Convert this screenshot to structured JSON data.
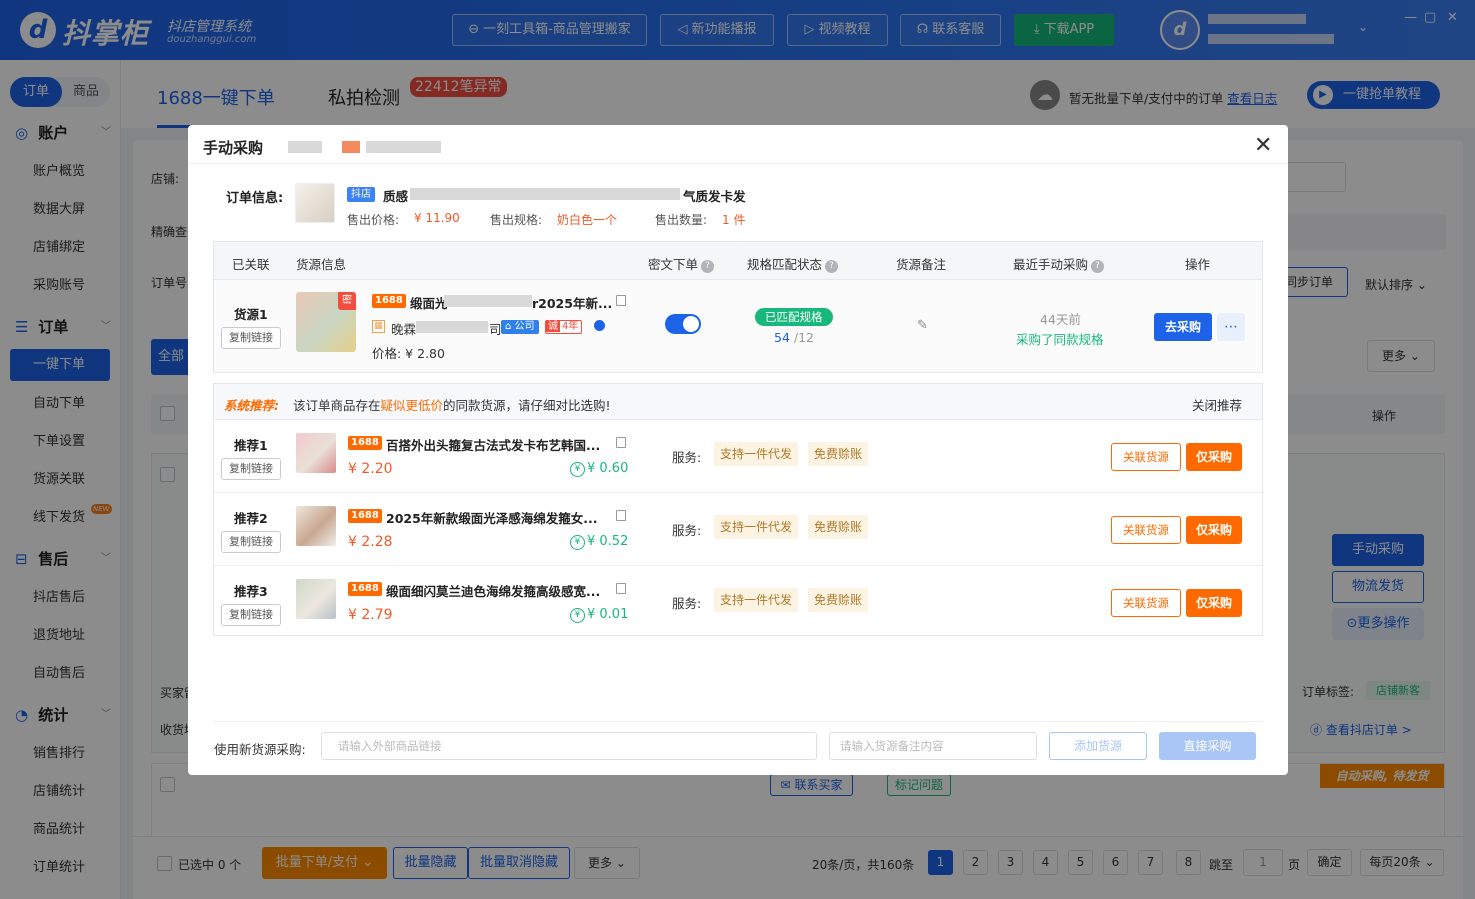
{
  "header": {
    "logo_mark": "d",
    "logo_text": "抖掌柜",
    "logo_subtitle": "抖店管理系统",
    "logo_url": "douzhanggui.com",
    "buttons": [
      "一刻工具箱-商品管理搬家",
      "新功能播报",
      "视频教程",
      "联系客服",
      "下载APP"
    ],
    "avatar_glyph": "d",
    "window_controls": [
      "—",
      "▢",
      "✕"
    ]
  },
  "sidebar": {
    "tabs": [
      "订单",
      "商品"
    ],
    "groups": [
      {
        "title": "账户",
        "items": [
          "账户概览",
          "数据大屏",
          "店铺绑定",
          "采购账号"
        ]
      },
      {
        "title": "订单",
        "items": [
          "一键下单",
          "自动下单",
          "下单设置",
          "货源关联",
          "线下发货"
        ]
      },
      {
        "title": "售后",
        "items": [
          "抖店售后",
          "退货地址",
          "自动售后"
        ]
      },
      {
        "title": "统计",
        "items": [
          "销售排行",
          "店铺统计",
          "商品统计",
          "订单统计"
        ]
      }
    ],
    "new_badge": "NEW"
  },
  "main": {
    "tab_active": "1688一键下单",
    "tab_private": "私拍检测",
    "tab_private_badge": "22412笔异常",
    "no_batch_msg": "暂无批量下单/支付中的订单",
    "view_log": "查看日志",
    "tutorial_btn": "一键抢单教程"
  },
  "background": {
    "shop_label": "店铺:",
    "precise_label": "精确查",
    "order_no_label": "订单号",
    "sync_orders": "同步订单",
    "default_sort": "默认排序",
    "all_btn": "全部",
    "more_btn": "更多",
    "op_header": "操作",
    "manual_purchase": "手动采购",
    "logistics_ship": "物流发货",
    "more_ops": "更多操作",
    "buyer_label": "买家留",
    "receiver_label": "收货地",
    "order_tag_label": "订单标签:",
    "order_tag_value": "店铺新客",
    "view_shop_order": "查看抖店订单 >",
    "contact_buyer": "联系买家",
    "mark_issue": "标记问题",
    "auto_status": "自动采购, 待发货",
    "selected": "已选中 0 个",
    "batch_order": "批量下单/支付",
    "batch_hide": "批量隐藏",
    "batch_unhide": "批量取消隐藏",
    "more_footer": "更多",
    "pagination_summary": "20条/页，共160条",
    "pages": [
      "1",
      "2",
      "3",
      "4",
      "5",
      "6",
      "7",
      "8"
    ],
    "jump_to": "跳至",
    "jump_value": "1",
    "page_unit": "页",
    "confirm": "确定",
    "per_page": "每页20条"
  },
  "modal": {
    "title": "手动采购",
    "order_info_label": "订单信息:",
    "shop_tag": "抖店",
    "product_title_start": "质感",
    "product_title_end": "气质发卡发",
    "sold_price_label": "售出价格:",
    "sold_price": "¥ 11.90",
    "sold_spec_label": "售出规格:",
    "sold_spec": "奶白色一个",
    "sold_qty_label": "售出数量:",
    "sold_qty": "1 件",
    "table_headers": [
      "已关联",
      "货源信息",
      "密文下单",
      "规格匹配状态",
      "货源备注",
      "最近手动采购",
      "操作"
    ],
    "source1": {
      "label": "货源1",
      "copy": "复制链接",
      "secret_tag": "密",
      "platform": "1688",
      "title_start": "缎面光",
      "title_end": "r2025年新...",
      "shop_start": "晚霖",
      "shop_end": "司",
      "company_tag": "公司",
      "cheng_tag": "诚",
      "years": "4年",
      "price": "价格: ¥ 2.80",
      "match_status": "已匹配规格",
      "match_count": "54",
      "match_total": "/12",
      "edit_icon": "✎",
      "last_ago": "44天前",
      "last_note": "采购了同款规格",
      "go_buy": "去采购",
      "more_icon": "⋯"
    },
    "recommend_title": "系统推荐:",
    "recommend_msg_pre": "该订单商品存在",
    "recommend_msg_hl": "疑似更低价",
    "recommend_msg_post": "的同款货源，请仔细对比选购!",
    "recommend_close": "关闭推荐",
    "recommendations": [
      {
        "label": "推荐1",
        "copy": "复制链接",
        "platform": "1688",
        "title": "百搭外出头箍复古法式发卡布艺韩国...",
        "price": "¥ 2.20",
        "rebate": "¥ 0.60",
        "service_label": "服务:",
        "tags": [
          "支持一件代发",
          "免费赊账"
        ],
        "link": "关联货源",
        "buy": "仅采购"
      },
      {
        "label": "推荐2",
        "copy": "复制链接",
        "platform": "1688",
        "title": "2025年新款缎面光泽感海绵发箍女...",
        "price": "¥ 2.28",
        "rebate": "¥ 0.52",
        "service_label": "服务:",
        "tags": [
          "支持一件代发",
          "免费赊账"
        ],
        "link": "关联货源",
        "buy": "仅采购"
      },
      {
        "label": "推荐3",
        "copy": "复制链接",
        "platform": "1688",
        "title": "缎面细闪莫兰迪色海绵发箍高级感宽...",
        "price": "¥ 2.79",
        "rebate": "¥ 0.01",
        "service_label": "服务:",
        "tags": [
          "支持一件代发",
          "免费赊账"
        ],
        "link": "关联货源",
        "buy": "仅采购"
      }
    ],
    "new_source_label": "使用新货源采购:",
    "link_placeholder": "请输入外部商品链接",
    "note_placeholder": "请输入货源备注内容",
    "add_source": "添加货源",
    "direct_buy": "直接采购"
  },
  "colors": {
    "brand": "#1d63e8",
    "orange": "#ff6a00",
    "green": "#18b87c",
    "red": "#f04e3e"
  }
}
